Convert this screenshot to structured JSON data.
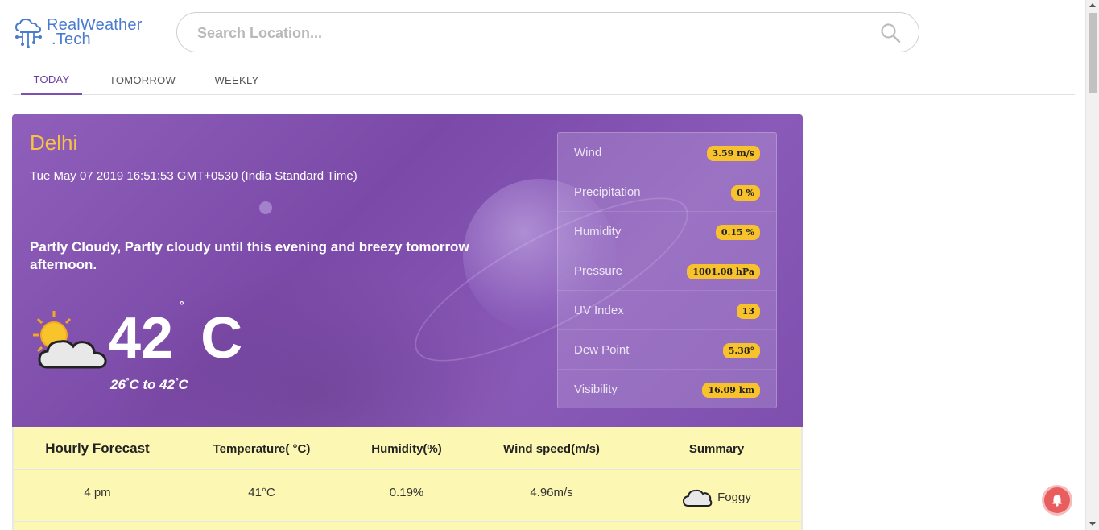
{
  "brand": {
    "line1": "RealWeather",
    "line2": ".Tech"
  },
  "search": {
    "placeholder": "Search Location..."
  },
  "tabs": [
    {
      "label": "TODAY",
      "active": true
    },
    {
      "label": "TOMORROW",
      "active": false
    },
    {
      "label": "WEEKLY",
      "active": false
    }
  ],
  "current": {
    "city": "Delhi",
    "datetime": "Tue May 07 2019 16:51:53 GMT+0530 (India Standard Time)",
    "summary": "Partly Cloudy, Partly cloudy until this evening and breezy tomorrow afternoon.",
    "temperature": "42",
    "degree_symbol": "°",
    "unit": "C",
    "range_low": "26",
    "range_high": "42",
    "range_text_to": "to",
    "icon": "partly-cloudy-day-icon"
  },
  "details": [
    {
      "label": "Wind",
      "value": "3.59 m/s"
    },
    {
      "label": "Precipitation",
      "value": "0 %"
    },
    {
      "label": "Humidity",
      "value": "0.15 %"
    },
    {
      "label": "Pressure",
      "value": "1001.08 hPa"
    },
    {
      "label": "UV Index",
      "value": "13"
    },
    {
      "label": "Dew Point",
      "value": "5.38°"
    },
    {
      "label": "Visibility",
      "value": "16.09 km"
    }
  ],
  "hourly": {
    "headers": [
      "Hourly Forecast",
      "Temperature( °C)",
      "Humidity(%)",
      "Wind speed(m/s)",
      "Summary"
    ],
    "rows": [
      {
        "time": "4 pm",
        "temperature": "41°C",
        "humidity": "0.19%",
        "wind": "4.96m/s",
        "summary": "Foggy",
        "icon": "cloud-icon"
      }
    ]
  },
  "colors": {
    "accent": "#7d4fb0",
    "city": "#f6c343",
    "badge": "#f8c22c",
    "table_bg": "#fdf7b4",
    "bell": "#e85d5d"
  }
}
